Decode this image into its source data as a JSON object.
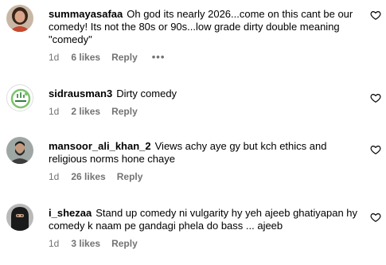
{
  "comments": [
    {
      "username": "summayasafaa",
      "text": "Oh god its nearly 2026...come on this cant be our comedy! Its not the 80s or 90s...low grade dirty double meaning \"comedy\"",
      "time": "1d",
      "likes": "6 likes",
      "reply": "Reply",
      "more": "•••",
      "avatar_icon": "woman-portrait-avatar"
    },
    {
      "username": "sidrausman3",
      "text": "Dirty comedy",
      "time": "1d",
      "likes": "2 likes",
      "reply": "Reply",
      "avatar_icon": "green-logo-avatar"
    },
    {
      "username": "mansoor_ali_khan_2",
      "text": "Views achy aye gy but kch ethics and religious norms hone chaye",
      "time": "1d",
      "likes": "26 likes",
      "reply": "Reply",
      "avatar_icon": "bearded-man-avatar"
    },
    {
      "username": "i_shezaa",
      "text": "Stand up comedy ni vulgarity hy yeh ajeeb ghatiyapan hy comedy k naam pe gandagi phela do bass ... ajeeb",
      "time": "1d",
      "likes": "3 likes",
      "reply": "Reply",
      "avatar_icon": "hooded-woman-avatar"
    }
  ],
  "colors": {
    "text": "#000000",
    "secondary": "#737373"
  }
}
